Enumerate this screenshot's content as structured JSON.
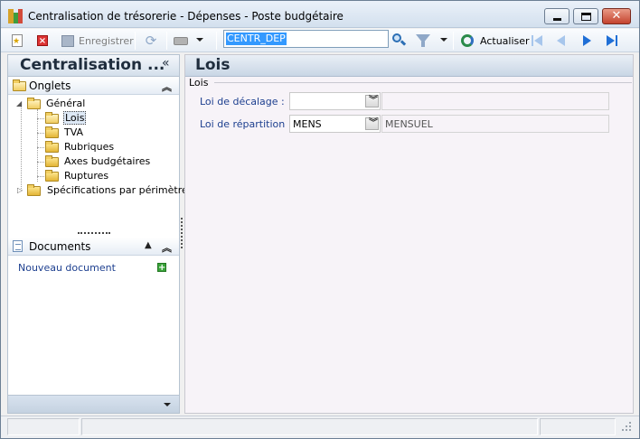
{
  "window": {
    "title": "Centralisation de trésorerie - Dépenses -  Poste budgétaire",
    "minimize_label": "",
    "maximize_label": "",
    "close_label": "✕"
  },
  "toolbar": {
    "save_label": "Enregistrer",
    "search_value": "CENTR_DEP",
    "refresh_label": "Actualiser"
  },
  "left_panel": {
    "title": "Centralisation ...",
    "collapse_glyph": "«",
    "tabs_section": {
      "label": "Onglets",
      "chevron": "⌃"
    },
    "tree": [
      {
        "label": "Général",
        "expanded": true
      },
      {
        "label": "Lois",
        "selected": true
      },
      {
        "label": "TVA"
      },
      {
        "label": "Rubriques"
      },
      {
        "label": "Axes budgétaires"
      },
      {
        "label": "Ruptures"
      },
      {
        "label": "Spécifications par périmètre",
        "expanded": false
      }
    ],
    "docs_section": {
      "label": "Documents",
      "up_glyph": "▲",
      "chevron": "⌃"
    },
    "new_document_label": "Nouveau document"
  },
  "main": {
    "title": "Lois",
    "group_label": "Lois",
    "fields": [
      {
        "label": "Loi de décalage :",
        "value": "",
        "description": ""
      },
      {
        "label": "Loi de répartition :",
        "value": "MENS",
        "description": "MENSUEL"
      }
    ]
  },
  "colors": {
    "link_blue": "#1d3f8f",
    "selection_blue": "#3399ff",
    "panel_bg": "#f7f3f8"
  },
  "icons": [
    "app-icon",
    "new-icon",
    "delete-icon",
    "save-icon",
    "refresh-icon",
    "print-icon",
    "search-icon",
    "filter-icon",
    "refresh-circle-icon",
    "first-icon",
    "previous-icon",
    "next-icon",
    "last-icon",
    "folder-icon",
    "document-icon",
    "add-icon"
  ]
}
